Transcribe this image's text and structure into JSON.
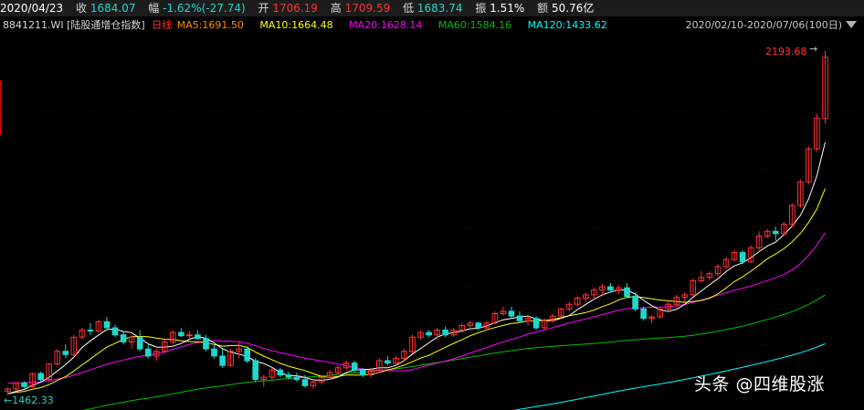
{
  "header": {
    "date": "2020/04/23",
    "close_label": "收",
    "close_value": "1684.07",
    "change_label": "幅",
    "change_value": "-1.62%(-27.74)",
    "open_label": "开",
    "open_value": "1706.19",
    "high_label": "高",
    "high_value": "1709.59",
    "low_label": "低",
    "low_value": "1683.74",
    "amplitude_label": "振",
    "amplitude_value": "1.51%",
    "amount_label": "额",
    "amount_value": "50.76亿"
  },
  "info": {
    "code": "8841211.WI",
    "name": "[陆股通增仓指数]",
    "period": "日线",
    "ma5": "MA5:1691.50",
    "ma10": "MA10:1664.48",
    "ma20": "MA20:1628.14",
    "ma60": "MA60:1584.16",
    "ma120": "MA120:1433.62",
    "range": "2020/02/10-2020/07/06(100日)"
  },
  "annotations": {
    "max_label": "2193.68",
    "max_arrow": "→",
    "min_label": "1462.33",
    "min_arrow": "←"
  },
  "watermark": "头条 @四维股涨",
  "colors": {
    "up": "#ff3232",
    "down": "#21d7cc",
    "ma5": "#ffffff",
    "ma10": "#ffff00",
    "ma20": "#ff00ff",
    "ma60": "#00c000",
    "ma120": "#00ffff",
    "grid": "#3a0000"
  },
  "chart_data": {
    "type": "candlestick",
    "x_range": [
      "2020/02/10",
      "2020/07/06"
    ],
    "count": 100,
    "ohlc": [
      [
        1470,
        1478,
        1462,
        1475
      ],
      [
        1475,
        1490,
        1470,
        1488
      ],
      [
        1488,
        1492,
        1476,
        1480
      ],
      [
        1480,
        1510,
        1478,
        1508
      ],
      [
        1508,
        1512,
        1490,
        1495
      ],
      [
        1495,
        1530,
        1492,
        1528
      ],
      [
        1528,
        1560,
        1525,
        1555
      ],
      [
        1555,
        1570,
        1540,
        1548
      ],
      [
        1548,
        1590,
        1545,
        1585
      ],
      [
        1585,
        1605,
        1580,
        1600
      ],
      [
        1600,
        1615,
        1590,
        1598
      ],
      [
        1598,
        1622,
        1595,
        1618
      ],
      [
        1618,
        1628,
        1600,
        1605
      ],
      [
        1605,
        1612,
        1585,
        1590
      ],
      [
        1590,
        1598,
        1570,
        1575
      ],
      [
        1575,
        1590,
        1560,
        1585
      ],
      [
        1585,
        1600,
        1555,
        1560
      ],
      [
        1560,
        1572,
        1540,
        1545
      ],
      [
        1545,
        1560,
        1535,
        1555
      ],
      [
        1555,
        1580,
        1550,
        1575
      ],
      [
        1575,
        1600,
        1570,
        1595
      ],
      [
        1595,
        1605,
        1585,
        1588
      ],
      [
        1588,
        1598,
        1575,
        1590
      ],
      [
        1590,
        1600,
        1580,
        1582
      ],
      [
        1582,
        1590,
        1555,
        1560
      ],
      [
        1560,
        1570,
        1540,
        1545
      ],
      [
        1545,
        1560,
        1520,
        1525
      ],
      [
        1525,
        1560,
        1522,
        1555
      ],
      [
        1555,
        1575,
        1540,
        1560
      ],
      [
        1560,
        1565,
        1530,
        1535
      ],
      [
        1535,
        1540,
        1490,
        1495
      ],
      [
        1495,
        1505,
        1480,
        1500
      ],
      [
        1500,
        1520,
        1495,
        1515
      ],
      [
        1515,
        1520,
        1500,
        1505
      ],
      [
        1505,
        1512,
        1495,
        1500
      ],
      [
        1500,
        1510,
        1490,
        1495
      ],
      [
        1495,
        1505,
        1478,
        1482
      ],
      [
        1482,
        1495,
        1475,
        1490
      ],
      [
        1490,
        1505,
        1485,
        1500
      ],
      [
        1500,
        1515,
        1495,
        1510
      ],
      [
        1510,
        1525,
        1505,
        1520
      ],
      [
        1520,
        1535,
        1515,
        1530
      ],
      [
        1530,
        1535,
        1510,
        1515
      ],
      [
        1515,
        1520,
        1500,
        1505
      ],
      [
        1505,
        1520,
        1500,
        1515
      ],
      [
        1515,
        1540,
        1512,
        1535
      ],
      [
        1535,
        1545,
        1525,
        1530
      ],
      [
        1530,
        1545,
        1525,
        1540
      ],
      [
        1540,
        1560,
        1535,
        1555
      ],
      [
        1555,
        1590,
        1550,
        1585
      ],
      [
        1585,
        1600,
        1580,
        1595
      ],
      [
        1595,
        1600,
        1585,
        1590
      ],
      [
        1590,
        1605,
        1580,
        1600
      ],
      [
        1600,
        1608,
        1585,
        1590
      ],
      [
        1590,
        1605,
        1585,
        1600
      ],
      [
        1600,
        1615,
        1595,
        1610
      ],
      [
        1610,
        1620,
        1605,
        1615
      ],
      [
        1615,
        1618,
        1600,
        1605
      ],
      [
        1605,
        1620,
        1600,
        1615
      ],
      [
        1615,
        1640,
        1612,
        1635
      ],
      [
        1635,
        1650,
        1630,
        1640
      ],
      [
        1640,
        1650,
        1625,
        1630
      ],
      [
        1630,
        1640,
        1615,
        1620
      ],
      [
        1620,
        1632,
        1610,
        1625
      ],
      [
        1625,
        1630,
        1600,
        1605
      ],
      [
        1605,
        1625,
        1600,
        1620
      ],
      [
        1620,
        1635,
        1615,
        1630
      ],
      [
        1630,
        1648,
        1625,
        1645
      ],
      [
        1645,
        1660,
        1640,
        1655
      ],
      [
        1655,
        1672,
        1650,
        1668
      ],
      [
        1668,
        1680,
        1660,
        1675
      ],
      [
        1675,
        1690,
        1665,
        1685
      ],
      [
        1685,
        1698,
        1675,
        1692
      ],
      [
        1692,
        1700,
        1680,
        1685
      ],
      [
        1685,
        1695,
        1678,
        1690
      ],
      [
        1690,
        1700,
        1670,
        1672
      ],
      [
        1672,
        1680,
        1640,
        1645
      ],
      [
        1645,
        1650,
        1620,
        1625
      ],
      [
        1625,
        1632,
        1615,
        1628
      ],
      [
        1628,
        1650,
        1625,
        1645
      ],
      [
        1645,
        1660,
        1640,
        1655
      ],
      [
        1655,
        1675,
        1650,
        1670
      ],
      [
        1670,
        1680,
        1660,
        1675
      ],
      [
        1675,
        1710,
        1672,
        1705
      ],
      [
        1705,
        1725,
        1700,
        1712
      ],
      [
        1712,
        1725,
        1706,
        1720
      ],
      [
        1720,
        1740,
        1715,
        1735
      ],
      [
        1735,
        1755,
        1730,
        1750
      ],
      [
        1750,
        1770,
        1745,
        1765
      ],
      [
        1765,
        1770,
        1740,
        1745
      ],
      [
        1745,
        1780,
        1742,
        1775
      ],
      [
        1775,
        1810,
        1770,
        1800
      ],
      [
        1800,
        1815,
        1795,
        1810
      ],
      [
        1810,
        1820,
        1790,
        1805
      ],
      [
        1805,
        1830,
        1800,
        1825
      ],
      [
        1825,
        1870,
        1820,
        1865
      ],
      [
        1865,
        1920,
        1860,
        1915
      ],
      [
        1915,
        1990,
        1910,
        1985
      ],
      [
        1985,
        2060,
        1980,
        2050
      ],
      [
        2050,
        2193.68,
        2040,
        2180
      ]
    ],
    "y_range": [
      1440,
      2220
    ],
    "ma_periods": [
      5,
      10,
      20,
      60,
      120
    ]
  }
}
